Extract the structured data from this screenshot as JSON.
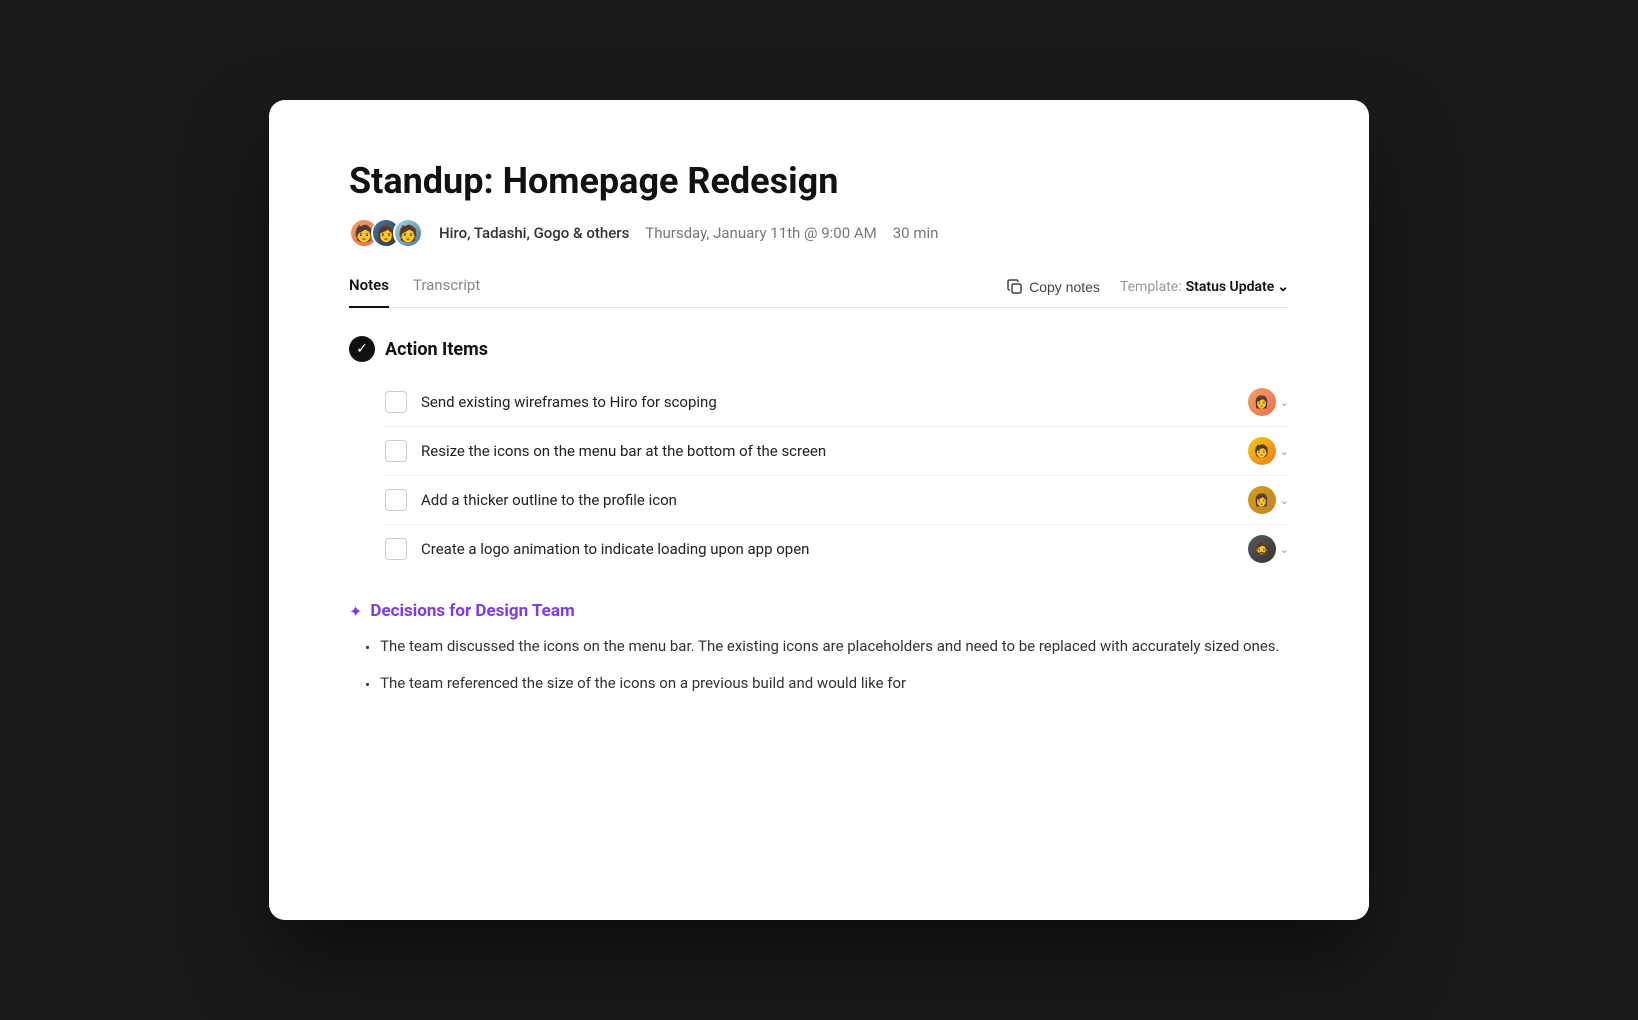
{
  "meeting": {
    "title": "Standup: Homepage Redesign",
    "attendees": "Hiro, Tadashi, Gogo & others",
    "date": "Thursday, January 11th @ 9:00 AM",
    "duration": "30 min"
  },
  "tabs": {
    "active": "Notes",
    "items": [
      "Notes",
      "Transcript"
    ]
  },
  "toolbar": {
    "copy_notes_label": "Copy notes",
    "template_label": "Template:",
    "template_value": "Status Update"
  },
  "action_items": {
    "section_title": "Action Items",
    "items": [
      {
        "text": "Send existing wireframes to Hiro for scoping",
        "avatar_class": "av-pink",
        "avatar_emoji": "👩"
      },
      {
        "text": "Resize the icons on the menu bar at the bottom of the screen",
        "avatar_class": "av-orange",
        "avatar_emoji": "🧑"
      },
      {
        "text": "Add a thicker outline to the profile icon",
        "avatar_class": "av-gold",
        "avatar_emoji": "👩"
      },
      {
        "text": "Create a logo animation to indicate loading upon app open",
        "avatar_class": "av-dark",
        "avatar_emoji": "🧔"
      }
    ]
  },
  "decisions": {
    "section_title": "Decisions for Design Team",
    "items": [
      "The team discussed the icons on the menu bar. The existing icons are placeholders and need to be replaced with accurately sized ones.",
      "The team referenced the size of the icons on a previous build and would like for"
    ]
  }
}
